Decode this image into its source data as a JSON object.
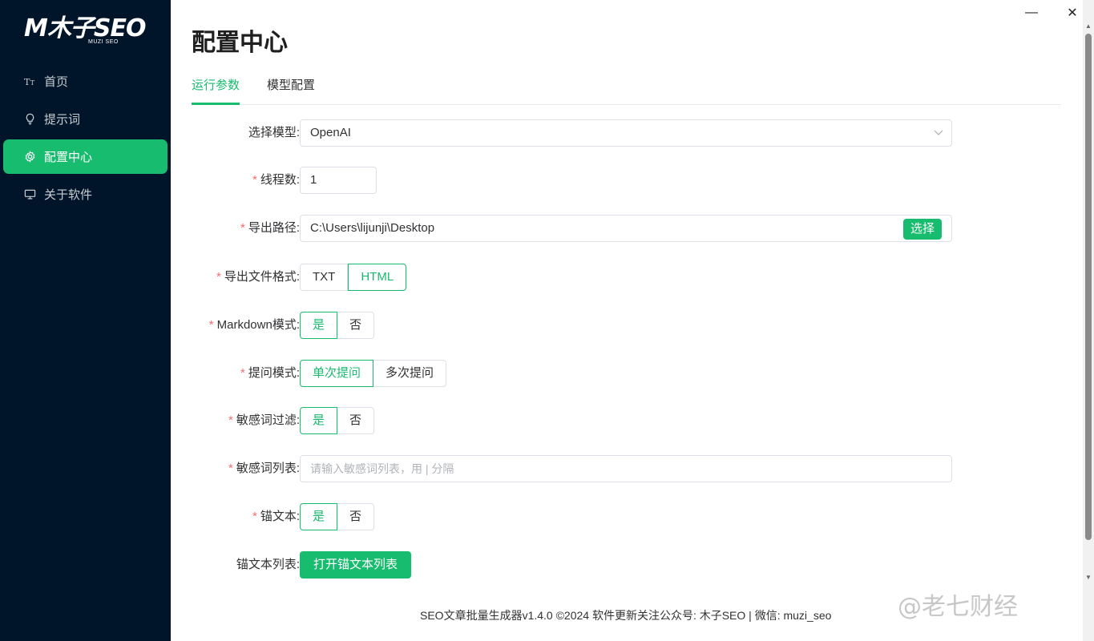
{
  "app": {
    "logo_text": "M木子SEO",
    "logo_sub": "MUZI SEO"
  },
  "sidebar": {
    "items": [
      {
        "label": "首页",
        "icon": "text-size-icon"
      },
      {
        "label": "提示词",
        "icon": "lightbulb-icon"
      },
      {
        "label": "配置中心",
        "icon": "gear-icon",
        "active": true
      },
      {
        "label": "关于软件",
        "icon": "monitor-icon"
      }
    ]
  },
  "window": {
    "minimize": "—",
    "close": "✕"
  },
  "page": {
    "title": "配置中心",
    "tabs": [
      {
        "label": "运行参数",
        "active": true
      },
      {
        "label": "模型配置",
        "active": false
      }
    ]
  },
  "form": {
    "model": {
      "label": "选择模型:",
      "value": "OpenAI"
    },
    "threads": {
      "label": "线程数:",
      "value": "1"
    },
    "export_path": {
      "label": "导出路径:",
      "value": "C:\\Users\\lijunji\\Desktop",
      "button": "选择"
    },
    "export_format": {
      "label": "导出文件格式:",
      "options": [
        "TXT",
        "HTML"
      ],
      "selected": "HTML"
    },
    "markdown": {
      "label": "Markdown模式:",
      "options": [
        "是",
        "否"
      ],
      "selected": "是"
    },
    "ask_mode": {
      "label": "提问模式:",
      "options": [
        "单次提问",
        "多次提问"
      ],
      "selected": "单次提问"
    },
    "sensitive_filter": {
      "label": "敏感词过滤:",
      "options": [
        "是",
        "否"
      ],
      "selected": "是"
    },
    "sensitive_list": {
      "label": "敏感词列表:",
      "placeholder": "请输入敏感词列表，用 | 分隔"
    },
    "anchor": {
      "label": "锚文本:",
      "options": [
        "是",
        "否"
      ],
      "selected": "是"
    },
    "anchor_list": {
      "label": "锚文本列表:",
      "button": "打开锚文本列表"
    }
  },
  "footer": {
    "text": "SEO文章批量生成器v1.4.0 ©2024 软件更新关注公众号: 木子SEO | 微信: muzi_seo"
  },
  "watermark": "@老七财经",
  "colors": {
    "sidebar_bg": "#001529",
    "accent": "#18bc6e",
    "required": "#f56c6c"
  }
}
